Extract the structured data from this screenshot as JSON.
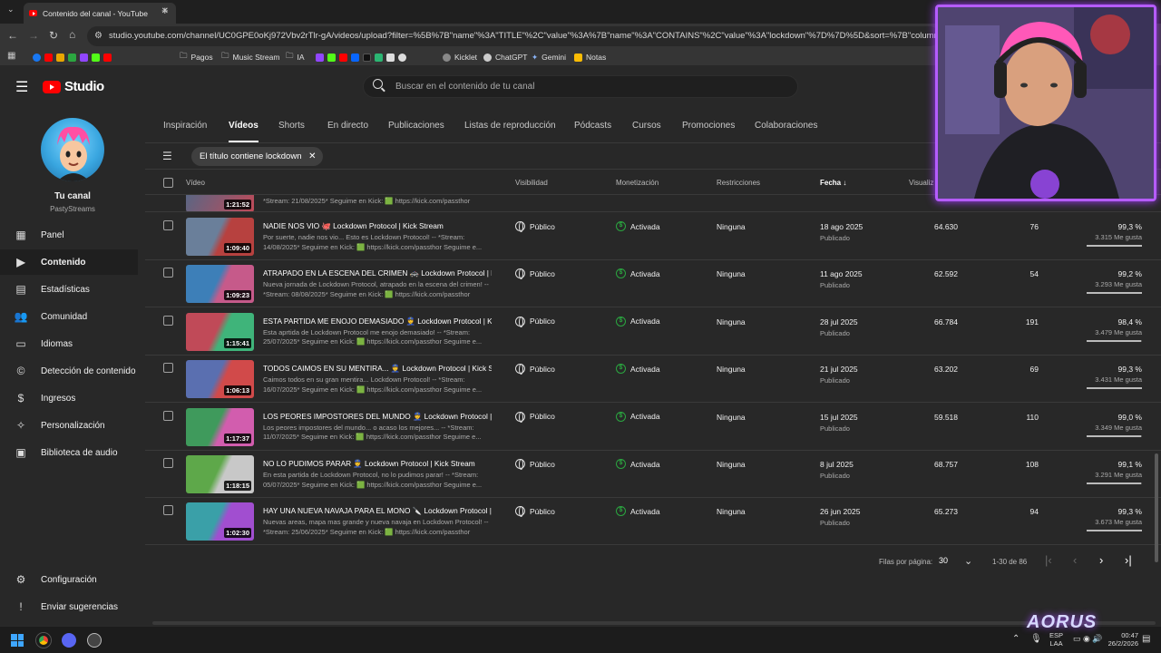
{
  "browser": {
    "tab_title": "Contenido del canal - YouTube",
    "url": "studio.youtube.com/channel/UC0GPE0oKj972Vbv2rTlr-gA/videos/upload?filter=%5B%7B\"name\"%3A\"TITLE\"%2C\"value\"%3A%7B\"name\"%3A\"CONTAINS\"%2C\"value\"%3A\"lockdown\"%7D%7D%5D&sort=%7B\"columnType\"%3A\"date\"%2C\"s",
    "bookmarks": [
      "Pagos",
      "Music Stream",
      "IA",
      "Kicklet",
      "ChatGPT",
      "Gemini",
      "Notas"
    ]
  },
  "studio": {
    "logo_text": "Studio",
    "search_placeholder": "Buscar en el contenido de tu canal"
  },
  "sidebar": {
    "channel_label": "Tu canal",
    "channel_name": "PastyStreams",
    "items": [
      {
        "label": "Panel",
        "icon": "dashboard-icon"
      },
      {
        "label": "Contenido",
        "icon": "content-icon"
      },
      {
        "label": "Estadísticas",
        "icon": "analytics-icon"
      },
      {
        "label": "Comunidad",
        "icon": "community-icon"
      },
      {
        "label": "Idiomas",
        "icon": "subtitles-icon"
      },
      {
        "label": "Detección de contenido",
        "icon": "copyright-icon"
      },
      {
        "label": "Ingresos",
        "icon": "dollar-icon"
      },
      {
        "label": "Personalización",
        "icon": "magic-wand-icon"
      },
      {
        "label": "Biblioteca de audio",
        "icon": "audio-library-icon"
      }
    ],
    "settings_label": "Configuración",
    "feedback_label": "Enviar sugerencias"
  },
  "tabs": [
    "Inspiración",
    "Vídeos",
    "Shorts",
    "En directo",
    "Publicaciones",
    "Listas de reproducción",
    "Pódcasts",
    "Cursos",
    "Promociones",
    "Colaboraciones"
  ],
  "filter_chip": "El título contiene lockdown",
  "columns": {
    "video": "Vídeo",
    "visibility": "Visibilidad",
    "monetization": "Monetización",
    "restrictions": "Restricciones",
    "date": "Fecha",
    "views": "Visualiz"
  },
  "partial_row": {
    "duration": "1:21:52",
    "desc": "*Stream: 21/08/2025* Seguime en Kick: 🟩 https://kick.com/passthor"
  },
  "rows": [
    {
      "title": "NADIE NOS VIO 🐙 Lockdown Protocol | Kick Stream",
      "desc1": "Por suerte, nadie nos vio... Esto es Lockdown Protocol! -- *Stream:",
      "desc2": "14/08/2025* Seguime en Kick: 🟩 https://kick.com/passthor Seguime e...",
      "duration": "1:09:40",
      "visibility": "Público",
      "monetization": "Activada",
      "restrictions": "Ninguna",
      "date": "18 ago 2025",
      "status": "Publicado",
      "views": "64.630",
      "comments": "76",
      "pct": "99,3 %",
      "likes": "3.315 Me gusta",
      "ratio": 0.993,
      "thumb": [
        "#6a7f9a",
        "#b7413f"
      ]
    },
    {
      "title": "ATRAPADO EN LA ESCENA DEL CRIMEN 🚓 Lockdown Protocol | Ki...",
      "desc1": "Nueva jornada de Lockdown Protocol, atrapado en la escena del crimen! --",
      "desc2": "*Stream: 08/08/2025* Seguime en Kick: 🟩 https://kick.com/passthor",
      "duration": "1:09:23",
      "visibility": "Público",
      "monetization": "Activada",
      "restrictions": "Ninguna",
      "date": "11 ago 2025",
      "status": "Publicado",
      "views": "62.592",
      "comments": "54",
      "pct": "99,2 %",
      "likes": "3.293 Me gusta",
      "ratio": 0.992,
      "thumb": [
        "#3d7fb8",
        "#c65a8a"
      ]
    },
    {
      "title": "ESTA PARTIDA ME ENOJO DEMASIADO 👮 Lockdown Protocol | Kic...",
      "desc1": "Esta aprtida de Lockdown Protocol me enojo demasiado! -- *Stream:",
      "desc2": "25/07/2025* Seguime en Kick: 🟩 https://kick.com/passthor Seguime e...",
      "duration": "1:15:41",
      "visibility": "Público",
      "monetization": "Activada",
      "restrictions": "Ninguna",
      "date": "28 jul 2025",
      "status": "Publicado",
      "views": "66.784",
      "comments": "191",
      "pct": "98,4 %",
      "likes": "3.479 Me gusta",
      "ratio": 0.984,
      "thumb": [
        "#c04a58",
        "#3fb47a"
      ]
    },
    {
      "title": "TODOS CAIMOS EN SU MENTIRA... 👮 Lockdown Protocol | Kick Str...",
      "desc1": "Caimos todos en su gran mentira... Lockdown Protocol! -- *Stream:",
      "desc2": "16/07/2025* Seguime en Kick: 🟩 https://kick.com/passthor Seguime e...",
      "duration": "1:06:13",
      "visibility": "Público",
      "monetization": "Activada",
      "restrictions": "Ninguna",
      "date": "21 jul 2025",
      "status": "Publicado",
      "views": "63.202",
      "comments": "69",
      "pct": "99,3 %",
      "likes": "3.431 Me gusta",
      "ratio": 0.993,
      "thumb": [
        "#5a6fb0",
        "#d14a4a"
      ]
    },
    {
      "title": "LOS PEORES IMPOSTORES DEL MUNDO 👮 Lockdown Protocol | Ki...",
      "desc1": "Los peores impostores del mundo... o acaso los mejores... -- *Stream:",
      "desc2": "11/07/2025* Seguime en Kick: 🟩 https://kick.com/passthor Seguime e...",
      "duration": "1:17:37",
      "visibility": "Público",
      "monetization": "Activada",
      "restrictions": "Ninguna",
      "date": "15 jul 2025",
      "status": "Publicado",
      "views": "59.518",
      "comments": "110",
      "pct": "99,0 %",
      "likes": "3.349 Me gusta",
      "ratio": 0.99,
      "thumb": [
        "#3f9a5c",
        "#d25dae"
      ]
    },
    {
      "title": "NO LO PUDIMOS PARAR 👮 Lockdown Protocol | Kick Stream",
      "desc1": "En esta partida de Lockdown Protocol, no lo pudimos parar! -- *Stream:",
      "desc2": "05/07/2025* Seguime en Kick: 🟩 https://kick.com/passthor Seguime e...",
      "duration": "1:18:15",
      "visibility": "Público",
      "monetization": "Activada",
      "restrictions": "Ninguna",
      "date": "8 jul 2025",
      "status": "Publicado",
      "views": "68.757",
      "comments": "108",
      "pct": "99,1 %",
      "likes": "3.291 Me gusta",
      "ratio": 0.991,
      "thumb": [
        "#5ea84a",
        "#c8c8c8"
      ]
    },
    {
      "title": "HAY UNA NUEVA NAVAJA PARA EL MONO 🔪 Lockdown Protocol | ...",
      "desc1": "Nuevas areas, mapa mas grande y nueva navaja en Lockdown Protocol! --",
      "desc2": "*Stream: 25/06/2025* Seguime en Kick: 🟩 https://kick.com/passthor",
      "duration": "1:02:30",
      "visibility": "Público",
      "monetization": "Activada",
      "restrictions": "Ninguna",
      "date": "26 jun 2025",
      "status": "Publicado",
      "views": "65.273",
      "comments": "94",
      "pct": "99,3 %",
      "likes": "3.673 Me gusta",
      "ratio": 0.993,
      "thumb": [
        "#3aa0a8",
        "#a14ed0"
      ]
    }
  ],
  "pagination": {
    "rows_label": "Filas por página:",
    "rows_value": "30",
    "range": "1-30 de 86"
  },
  "taskbar": {
    "lang1": "ESP",
    "lang2": "LAA",
    "time": "00:47",
    "date": "26/2/2026"
  },
  "colors": {
    "accent_red": "#ff0000",
    "monetized_green": "#2ba640",
    "webcam_border": "#b55cff"
  }
}
